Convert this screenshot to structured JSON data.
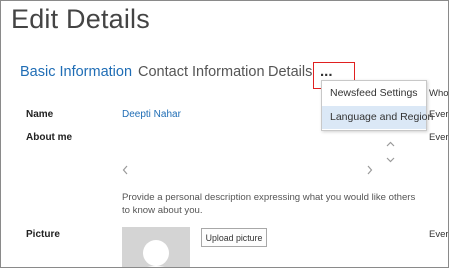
{
  "page": {
    "title": "Edit Details"
  },
  "tabs": {
    "basic": "Basic Information",
    "contact": "Contact Information",
    "details": "Details",
    "more": "..."
  },
  "more_menu": {
    "items": [
      "Newsfeed Settings",
      "Language and Region"
    ],
    "highlighted_index": 1
  },
  "form": {
    "name_label": "Name",
    "name_value": "Deepti Nahar",
    "about_label": "About me",
    "about_help": "Provide a personal description expressing what you would like others to know about you.",
    "picture_label": "Picture",
    "upload_button": "Upload picture"
  },
  "right_column": {
    "header": "Who",
    "row_name": "Every",
    "row_about": "Every",
    "row_picture": "Every"
  },
  "colors": {
    "accent": "#1f6db5",
    "highlight": "#dbe8f6",
    "outline": "#e02020"
  },
  "icons": {
    "scroll_up": "chevron-up-icon",
    "scroll_down": "chevron-down-icon",
    "scroll_left": "chevron-left-icon",
    "scroll_right": "chevron-right-icon",
    "avatar": "avatar-placeholder-icon"
  }
}
